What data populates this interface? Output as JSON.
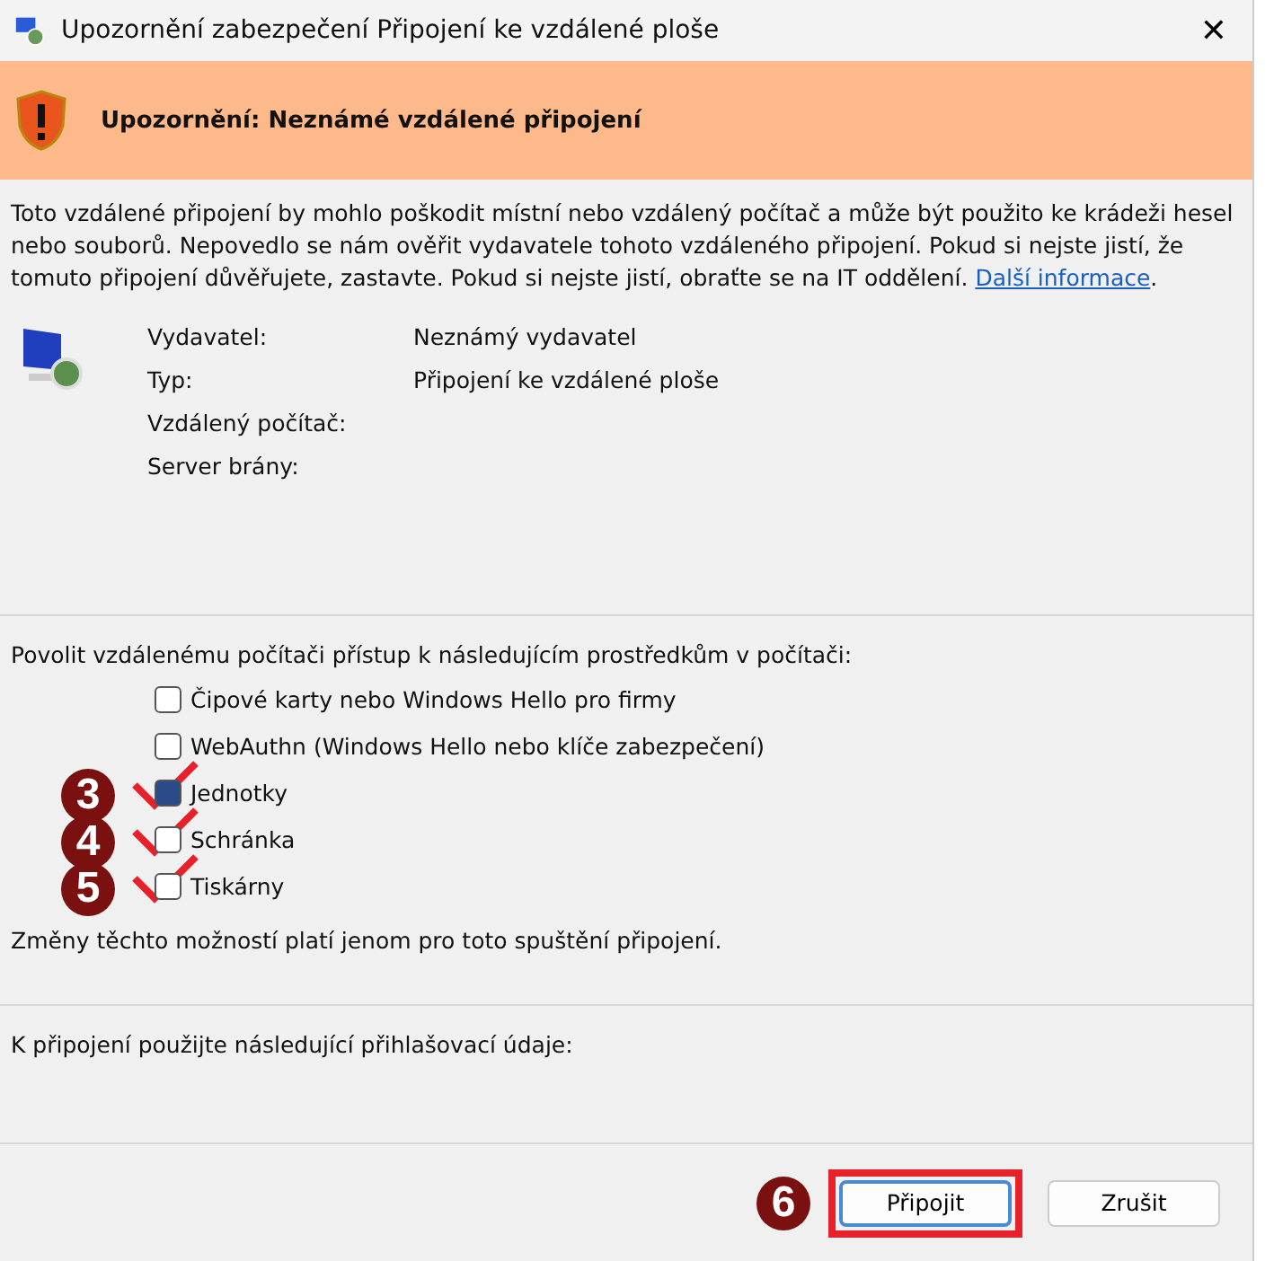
{
  "window": {
    "title": "Upozornění zabezpečení Připojení ke vzdálené ploše",
    "close": "✕"
  },
  "banner": {
    "title": "Upozornění: Neznámé vzdálené připojení"
  },
  "warning": {
    "text": "Toto vzdálené připojení by mohlo poškodit místní nebo vzdálený počítač a může být použito ke krádeži hesel nebo souborů. Nepovedlo se nám ověřit vydavatele tohoto vzdáleného připojení. Pokud si nejste jistí, že tomuto připojení důvěřujete, zastavte. Pokud si nejste jistí, obraťte se na IT oddělení.",
    "link": "Další informace",
    "after": "."
  },
  "details": [
    {
      "label": "Vydavatel:",
      "value": "Neznámý vydavatel"
    },
    {
      "label": "Typ:",
      "value": "Připojení ke vzdálené ploše"
    },
    {
      "label": "Vzdálený počítač:"
    },
    {
      "label": "Server brány:"
    }
  ],
  "resources": {
    "heading": "Povolit vzdálenému počítači přístup k následujícím prostředkům v počítači:",
    "items": [
      {
        "label": "Čipové karty nebo Windows Hello pro firmy",
        "checked": false
      },
      {
        "label": "WebAuthn (Windows Hello nebo klíče zabezpečení)",
        "checked": false
      },
      {
        "label": "Jednotky",
        "checked": true,
        "step": "3"
      },
      {
        "label": "Schránka",
        "checked": false,
        "step": "4"
      },
      {
        "label": "Tiskárny",
        "checked": false,
        "step": "5"
      }
    ],
    "note": "Změny těchto možností platí jenom pro toto spuštění připojení."
  },
  "credentials": {
    "text": "K připojení použijte následující přihlašovací údaje:"
  },
  "buttons": [
    {
      "label": "Připojit",
      "highlighted": true,
      "step": "6"
    },
    {
      "label": "Zrušit",
      "highlighted": false
    }
  ]
}
